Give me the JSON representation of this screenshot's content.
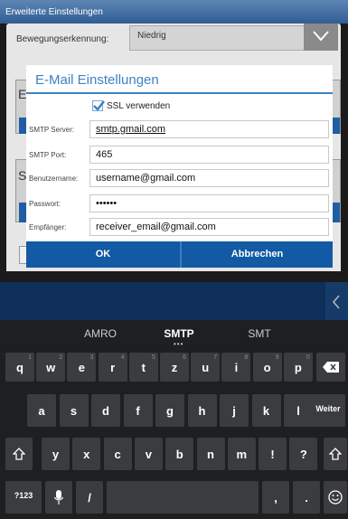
{
  "app": {
    "title": "Erweiterte Einstellungen",
    "motion_label": "Bewegungserkennung:",
    "motion_value": "Niedrig",
    "peek_letters": [
      "E",
      "S"
    ]
  },
  "dialog": {
    "title": "E-Mail Einstellungen",
    "ssl_label": "SSL verwenden",
    "ssl_checked": true,
    "fields": [
      {
        "label": "SMTP Server:",
        "value": "smtp.gmail.com"
      },
      {
        "label": "SMTP Port:",
        "value": "465"
      },
      {
        "label": "Benutzername:",
        "value": "username@gmail.com"
      },
      {
        "label": "Passwort:",
        "value": "••••••"
      },
      {
        "label": "Empfänger:",
        "value": "receiver_email@gmail.com"
      }
    ],
    "ok_label": "OK",
    "cancel_label": "Abbrechen"
  },
  "keyboard": {
    "suggestions": [
      "AMRO",
      "SMTP",
      "SMT"
    ],
    "row1": [
      {
        "key": "q",
        "hint": "1"
      },
      {
        "key": "w",
        "hint": "2"
      },
      {
        "key": "e",
        "hint": "3"
      },
      {
        "key": "r",
        "hint": "4"
      },
      {
        "key": "t",
        "hint": "5"
      },
      {
        "key": "z",
        "hint": "6"
      },
      {
        "key": "u",
        "hint": "7"
      },
      {
        "key": "i",
        "hint": "8"
      },
      {
        "key": "o",
        "hint": "9"
      },
      {
        "key": "p",
        "hint": "0"
      }
    ],
    "row2": [
      "a",
      "s",
      "d",
      "f",
      "g",
      "h",
      "j",
      "k",
      "l"
    ],
    "row3": [
      "y",
      "x",
      "c",
      "v",
      "b",
      "n",
      "m",
      "!",
      "?"
    ],
    "enter_label": "Weiter",
    "symbols_label": "?123",
    "slash_label": "/",
    "comma_label": ",",
    "period_label": ".",
    "colors": {
      "accent": "#3d82c4",
      "button": "#125aa3",
      "key": "#3a3c3f"
    }
  }
}
